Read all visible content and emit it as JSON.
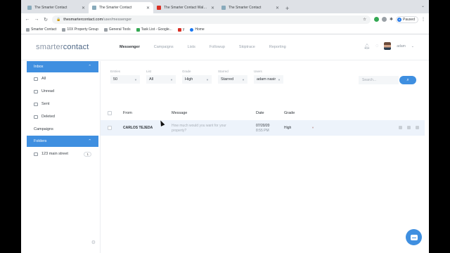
{
  "browser": {
    "tabs": [
      {
        "title": "The Smarter Contact",
        "active": false
      },
      {
        "title": "The Smarter Contact",
        "active": true
      },
      {
        "title": "The Smarter Contact Walkthrough",
        "active": false
      },
      {
        "title": "The Smarter Contact",
        "active": false
      }
    ],
    "url_host": "thesmartercontact.com",
    "url_path": "/user/messenger",
    "profile_label": "Paused",
    "profile_initial": "A",
    "bookmarks": [
      "Smarter Contact",
      "10X Property Group",
      "General Tools",
      "Task List - Google...",
      "y",
      "Home"
    ]
  },
  "app": {
    "logo_light": "smarter",
    "logo_dark": "contact",
    "nav": [
      "Messenger",
      "Campaigns",
      "Lists",
      "Followup",
      "Skiptrace",
      "Reporting"
    ],
    "active_nav": "Messenger",
    "user_name": "adam"
  },
  "sidebar": {
    "inbox_label": "Inbox",
    "inbox_items": [
      "All",
      "Unread",
      "Sent",
      "Deleted"
    ],
    "campaigns_label": "Campaigns",
    "folders_label": "Folders",
    "folders": [
      {
        "name": "123 main street",
        "count": "1"
      }
    ]
  },
  "filters": {
    "items": [
      {
        "label": "Entries",
        "value": "50"
      },
      {
        "label": "List",
        "value": "All"
      },
      {
        "label": "Grade",
        "value": "High"
      },
      {
        "label": "Starred",
        "value": "Starred"
      },
      {
        "label": "Users",
        "value": "adam nasir"
      }
    ],
    "search_placeholder": "Search..."
  },
  "table": {
    "headers": {
      "from": "From",
      "message": "Message",
      "date": "Date",
      "grade": "Grade"
    },
    "rows": [
      {
        "from": "CARLOS TEJEDA",
        "message": "How much would you want for your property?",
        "date": "07/20/20",
        "time": "8:55 PM",
        "grade": "High"
      }
    ]
  },
  "colors": {
    "accent": "#3f8fe0",
    "row_highlight": "#edf3fb"
  }
}
